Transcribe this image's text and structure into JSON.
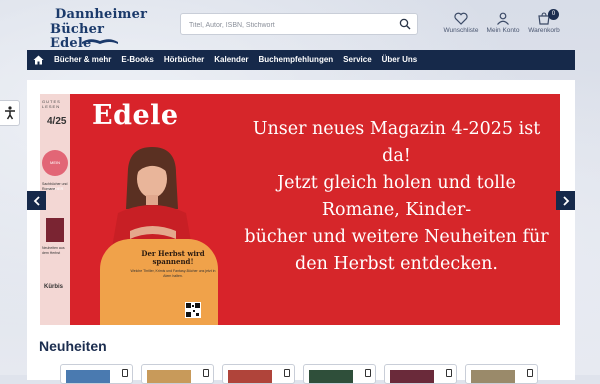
{
  "logo": {
    "line1": "Dannheimer",
    "line2": "Bücher Edele"
  },
  "search": {
    "placeholder": "Titel, Autor, ISBN, Stichwort"
  },
  "header_icons": [
    {
      "name": "heart-icon",
      "label": "Wunschliste"
    },
    {
      "name": "user-icon",
      "label": "Mein Konto"
    },
    {
      "name": "cart-icon",
      "label": "Warenkorb",
      "badge": "0"
    }
  ],
  "nav": {
    "items": [
      "Bücher & mehr",
      "E-Books",
      "Hörbücher",
      "Kalender",
      "Buchempfehlungen",
      "Service",
      "Über Uns"
    ]
  },
  "banner": {
    "magazine": {
      "title": "Edele",
      "strip_label": "GUTES LESEN",
      "issue": "4/25",
      "circle_text": "MEIN BÜCHER",
      "strip_text1": "Sachbücher und Romane",
      "strip_text2": "Neuheiten aus dem Herbst",
      "strip_keyword": "Kürbis",
      "headline": "Der Herbst wird spannend!",
      "teaser": "Welche Thriller, Krimis und Fantasy-Bücher uns jetzt in Atem halten."
    },
    "text_lines": [
      "Unser neues Magazin 4-2025 ist",
      "da!",
      "Jetzt gleich holen und tolle",
      "Romane, Kinder-",
      "bücher und weitere Neuheiten für",
      "den Herbst entdecken."
    ],
    "bg_color": "#d6262a"
  },
  "section": {
    "title": "Neuheiten"
  },
  "product_covers": [
    "#4a7ab0",
    "#c89a5a",
    "#b0443a",
    "#2f4f3a",
    "#6a2a3a",
    "#9a8a6a"
  ],
  "colors": {
    "nav_bg": "#16294a",
    "brand": "#1b3a6b"
  }
}
